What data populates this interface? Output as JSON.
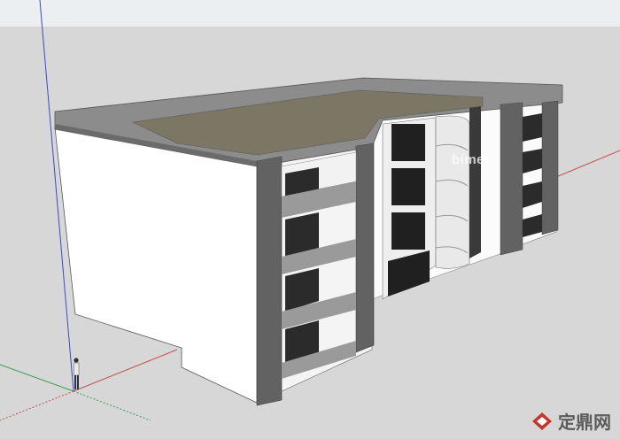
{
  "viewport": {
    "sky_color": "#eceff2",
    "ground_color": "#d7d7d7"
  },
  "axes": {
    "red": "#c45050",
    "green": "#3b9e55",
    "blue": "#3f46c8"
  },
  "model": {
    "frame_color": "#6a6a6a",
    "wall_color": "#ffffff",
    "roof_color": "#8a8a8a",
    "glass_color": "#262626"
  },
  "watermarks": [
    "bimer",
    "bimer"
  ],
  "brand": {
    "logo_text": "定鼎网",
    "accent_color": "#c8342c"
  }
}
